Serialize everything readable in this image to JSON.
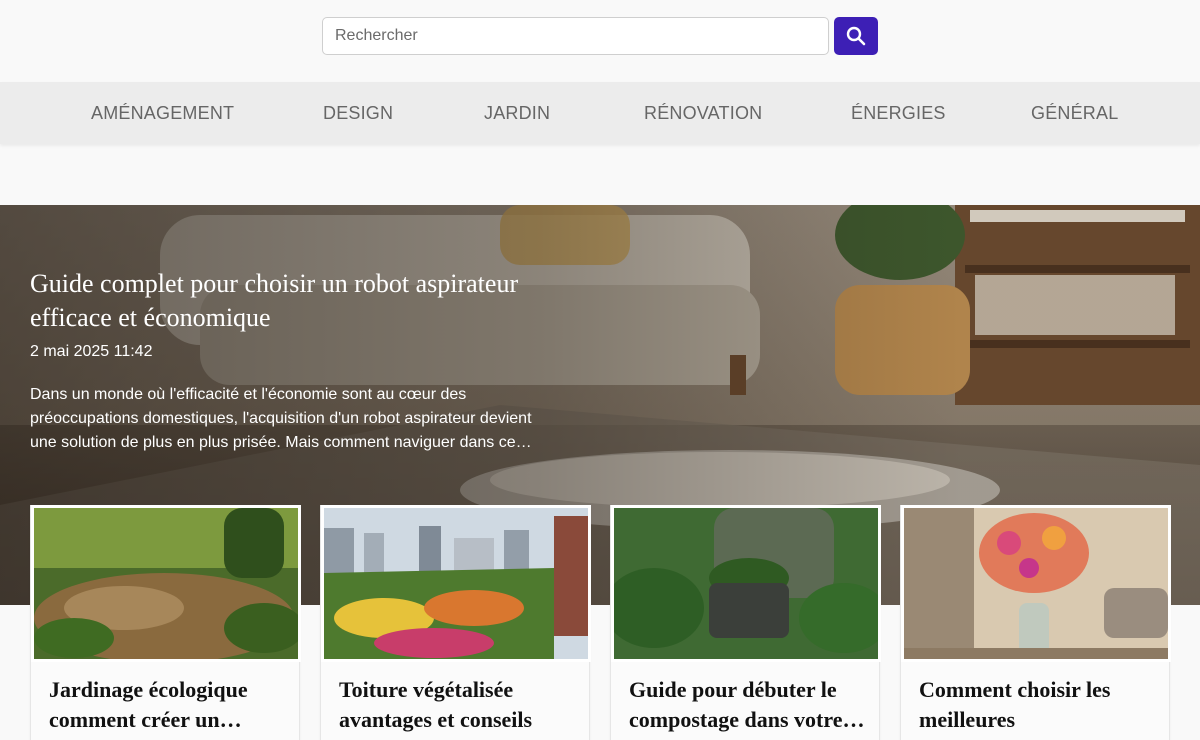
{
  "search": {
    "placeholder": "Rechercher",
    "button_icon": "search-icon"
  },
  "nav": {
    "items": [
      {
        "label": "AMÉNAGEMENT"
      },
      {
        "label": "DESIGN"
      },
      {
        "label": "JARDIN"
      },
      {
        "label": "RÉNOVATION"
      },
      {
        "label": "ÉNERGIES"
      },
      {
        "label": "GÉNÉRAL"
      }
    ]
  },
  "hero": {
    "title": "Guide complet pour choisir un robot aspirateur efficace et économique",
    "date": "2 mai 2025 11:42",
    "excerpt": "Dans un monde où l'efficacité et l'économie sont au cœur des préoccupations domestiques, l'acquisition d'un robot aspirateur devient une solution de plus en plus prisée. Mais comment naviguer dans ce…"
  },
  "cards": [
    {
      "title": "Jardinage écologique comment créer un…"
    },
    {
      "title": "Toiture végétalisée avantages et conseils po…"
    },
    {
      "title": "Guide pour débuter le compostage dans votre…"
    },
    {
      "title": "Comment choisir les meilleures compositions…"
    }
  ],
  "colors": {
    "accent": "#3d1fb5",
    "nav_bg": "#ececec",
    "page_bg": "#f9f9f9"
  }
}
